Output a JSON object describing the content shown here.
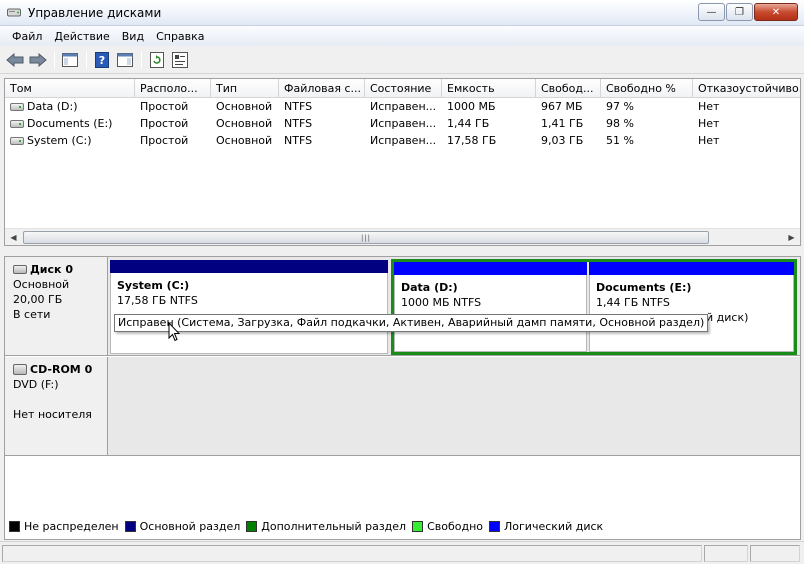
{
  "window": {
    "title": "Управление дисками",
    "min": "—",
    "max": "❐",
    "close": "✕"
  },
  "menu": [
    "Файл",
    "Действие",
    "Вид",
    "Справка"
  ],
  "volume_list": {
    "columns": [
      "Том",
      "Располо...",
      "Тип",
      "Файловая с...",
      "Состояние",
      "Емкость",
      "Свобод...",
      "Свободно %",
      "Отказоустойчиво..."
    ],
    "rows": [
      [
        "Data (D:)",
        "Простой",
        "Основной",
        "NTFS",
        "Исправен...",
        "1000 МБ",
        "967 МБ",
        "97 %",
        "Нет"
      ],
      [
        "Documents (E:)",
        "Простой",
        "Основной",
        "NTFS",
        "Исправен...",
        "1,44 ГБ",
        "1,41 ГБ",
        "98 %",
        "Нет"
      ],
      [
        "System (C:)",
        "Простой",
        "Основной",
        "NTFS",
        "Исправен...",
        "17,58 ГБ",
        "9,03 ГБ",
        "51 %",
        "Нет"
      ]
    ],
    "scroll_grip": "|||"
  },
  "disks": [
    {
      "name": "Диск 0",
      "type": "Основной",
      "size": "20,00 ГБ",
      "status": "В сети",
      "partitions": [
        {
          "name": "System  (C:)",
          "size": "17,58 ГБ NTFS",
          "status": ""
        },
        {
          "name": "Data  (D:)",
          "size": "1000 МБ NTFS",
          "status": ""
        },
        {
          "name": "Documents  (E:)",
          "size": "1,44 ГБ NTFS",
          "status": "гический диск)"
        }
      ]
    },
    {
      "name": "CD-ROM 0",
      "type": "DVD (F:)",
      "status": "Нет носителя"
    }
  ],
  "tooltip": "Исправен (Система, Загрузка, Файл подкачки, Активен, Аварийный дамп памяти, Основной раздел)",
  "legend": [
    {
      "label": "Не распределен",
      "color": "#000000"
    },
    {
      "label": "Основной раздел",
      "color": "#000080"
    },
    {
      "label": "Дополнительный раздел",
      "color": "#008000"
    },
    {
      "label": "Свободно",
      "color": "#33ee33"
    },
    {
      "label": "Логический диск",
      "color": "#0000ff"
    }
  ],
  "colors": {
    "primary_partition": "#000080",
    "logical_drive": "#0000ff",
    "extended_partition": "#1a8c1a"
  }
}
